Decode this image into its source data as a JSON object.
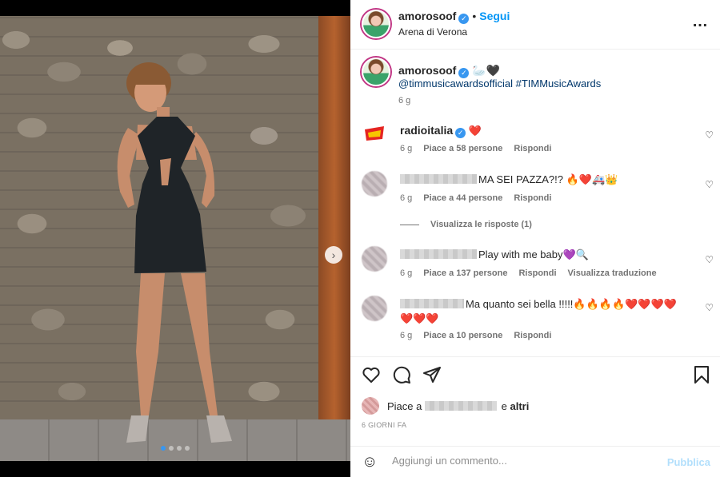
{
  "media": {
    "slide_count": 4,
    "active_slide": 1,
    "next_icon": "chevron-right-icon"
  },
  "header": {
    "username": "amorosoof",
    "verified_icon": "verified-badge-icon",
    "separator": "•",
    "follow_label": "Segui",
    "location": "Arena di Verona",
    "more_icon": "…"
  },
  "caption": {
    "username": "amorosoof",
    "emojis": "🦢🖤",
    "text": "@timmusicawardsofficial #TIMMusicAwards",
    "time": "6 g"
  },
  "comments": [
    {
      "username": "radioitalia",
      "verified": true,
      "text": "❤️",
      "time": "6 g",
      "likes": "Piace a 58 persone",
      "reply": "Rispondi"
    },
    {
      "username": "",
      "text": "MA SEI PAZZA?!? 🔥❤️🚑👑",
      "time": "6 g",
      "likes": "Piace a 44 persone",
      "reply": "Rispondi",
      "view_replies": "Visualizza le risposte (1)"
    },
    {
      "username": "",
      "text": "Play with me baby💜🔍",
      "time": "6 g",
      "likes": "Piace a 137 persone",
      "reply": "Rispondi",
      "translate": "Visualizza traduzione"
    },
    {
      "username": "",
      "text": "Ma quanto sei bella !!!!!🔥🔥🔥🔥❤️❤️❤️❤️❤️❤️❤️",
      "time": "6 g",
      "likes": "Piace a 10 persone",
      "reply": "Rispondi"
    }
  ],
  "actions": {
    "like_icon": "heart-icon",
    "comment_icon": "comment-icon",
    "share_icon": "share-icon",
    "save_icon": "bookmark-icon"
  },
  "likes": {
    "prefix": "Piace a",
    "conjunction": "e",
    "others": "altri"
  },
  "date": "6 GIORNI FA",
  "add_comment": {
    "placeholder": "Aggiungi un commento...",
    "publish_label": "Pubblica"
  },
  "colors": {
    "link_blue": "#0095f6",
    "publish_disabled": "#b2dffc",
    "verified": "#3897f0",
    "heart": "#ed4956"
  }
}
